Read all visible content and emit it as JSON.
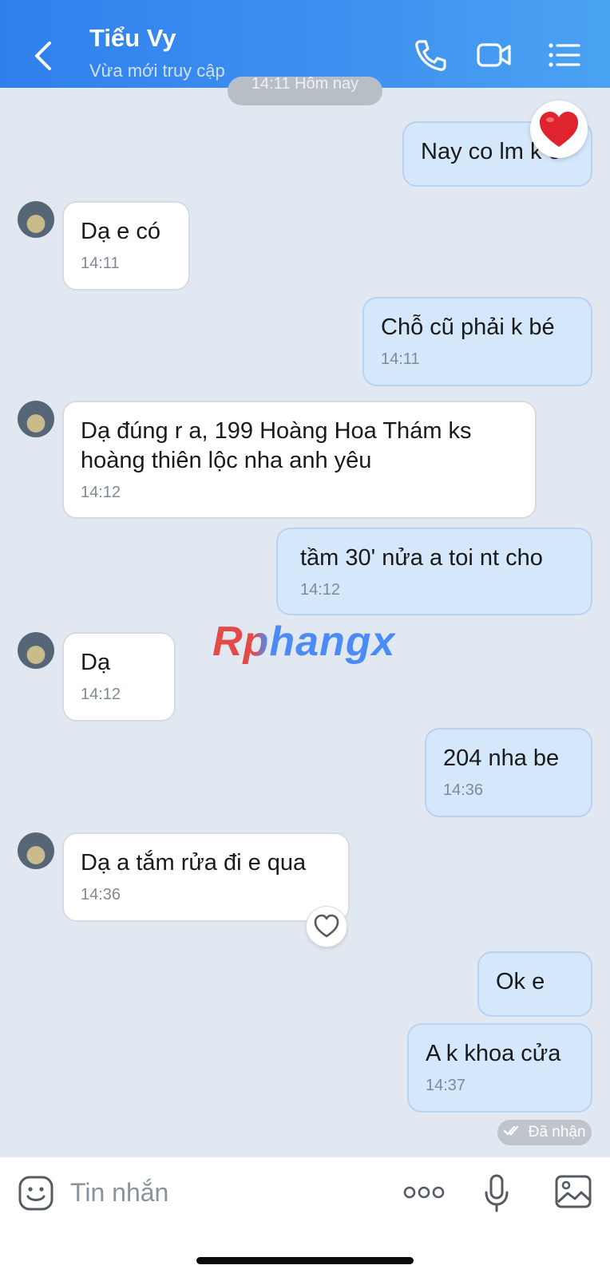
{
  "header": {
    "contact_name": "Tiểu Vy",
    "contact_status": "Vừa mới truy cập",
    "icons": [
      "back-arrow-icon",
      "phone-icon",
      "video-call-icon",
      "menu-list-icon"
    ],
    "accent": "#2f80ed"
  },
  "date_separator": "14:11 Hôm nay",
  "messages": [
    {
      "dir": "out",
      "text": "Nay co lm k e",
      "time": "",
      "reaction": "heart"
    },
    {
      "dir": "in",
      "text": "Dạ e có",
      "time": "14:11"
    },
    {
      "dir": "out",
      "text": "Chỗ cũ phải k bé",
      "time": "14:11"
    },
    {
      "dir": "in",
      "text_line1": "Dạ đúng r a, 199 Hoàng Hoa Thám ks",
      "text_line2": "hoàng thiên lộc nha anh yêu",
      "time": "14:12"
    },
    {
      "dir": "out",
      "text": "tầm 30' nửa a toi nt cho",
      "time": "14:12"
    },
    {
      "dir": "in",
      "text": "Dạ",
      "time": "14:12"
    },
    {
      "dir": "out",
      "text": "204 nha be",
      "time": "14:36"
    },
    {
      "dir": "in",
      "text": "Dạ a tắm rửa đi e qua",
      "time": "14:36"
    },
    {
      "dir": "out",
      "text": "Ok e",
      "time": ""
    },
    {
      "dir": "out",
      "text": "A k khoa cửa",
      "time": "14:37"
    }
  ],
  "watermark": "Rphangx",
  "delivery_status": "Đã nhận",
  "composer": {
    "placeholder": "Tin nhắn",
    "icons": [
      "sticker-icon",
      "more-icon",
      "microphone-icon",
      "image-icon"
    ]
  },
  "colors": {
    "chat_bg": "#e2e8f1",
    "incoming_bubble": "#ffffff",
    "outgoing_bubble": "#d4e7fb"
  }
}
